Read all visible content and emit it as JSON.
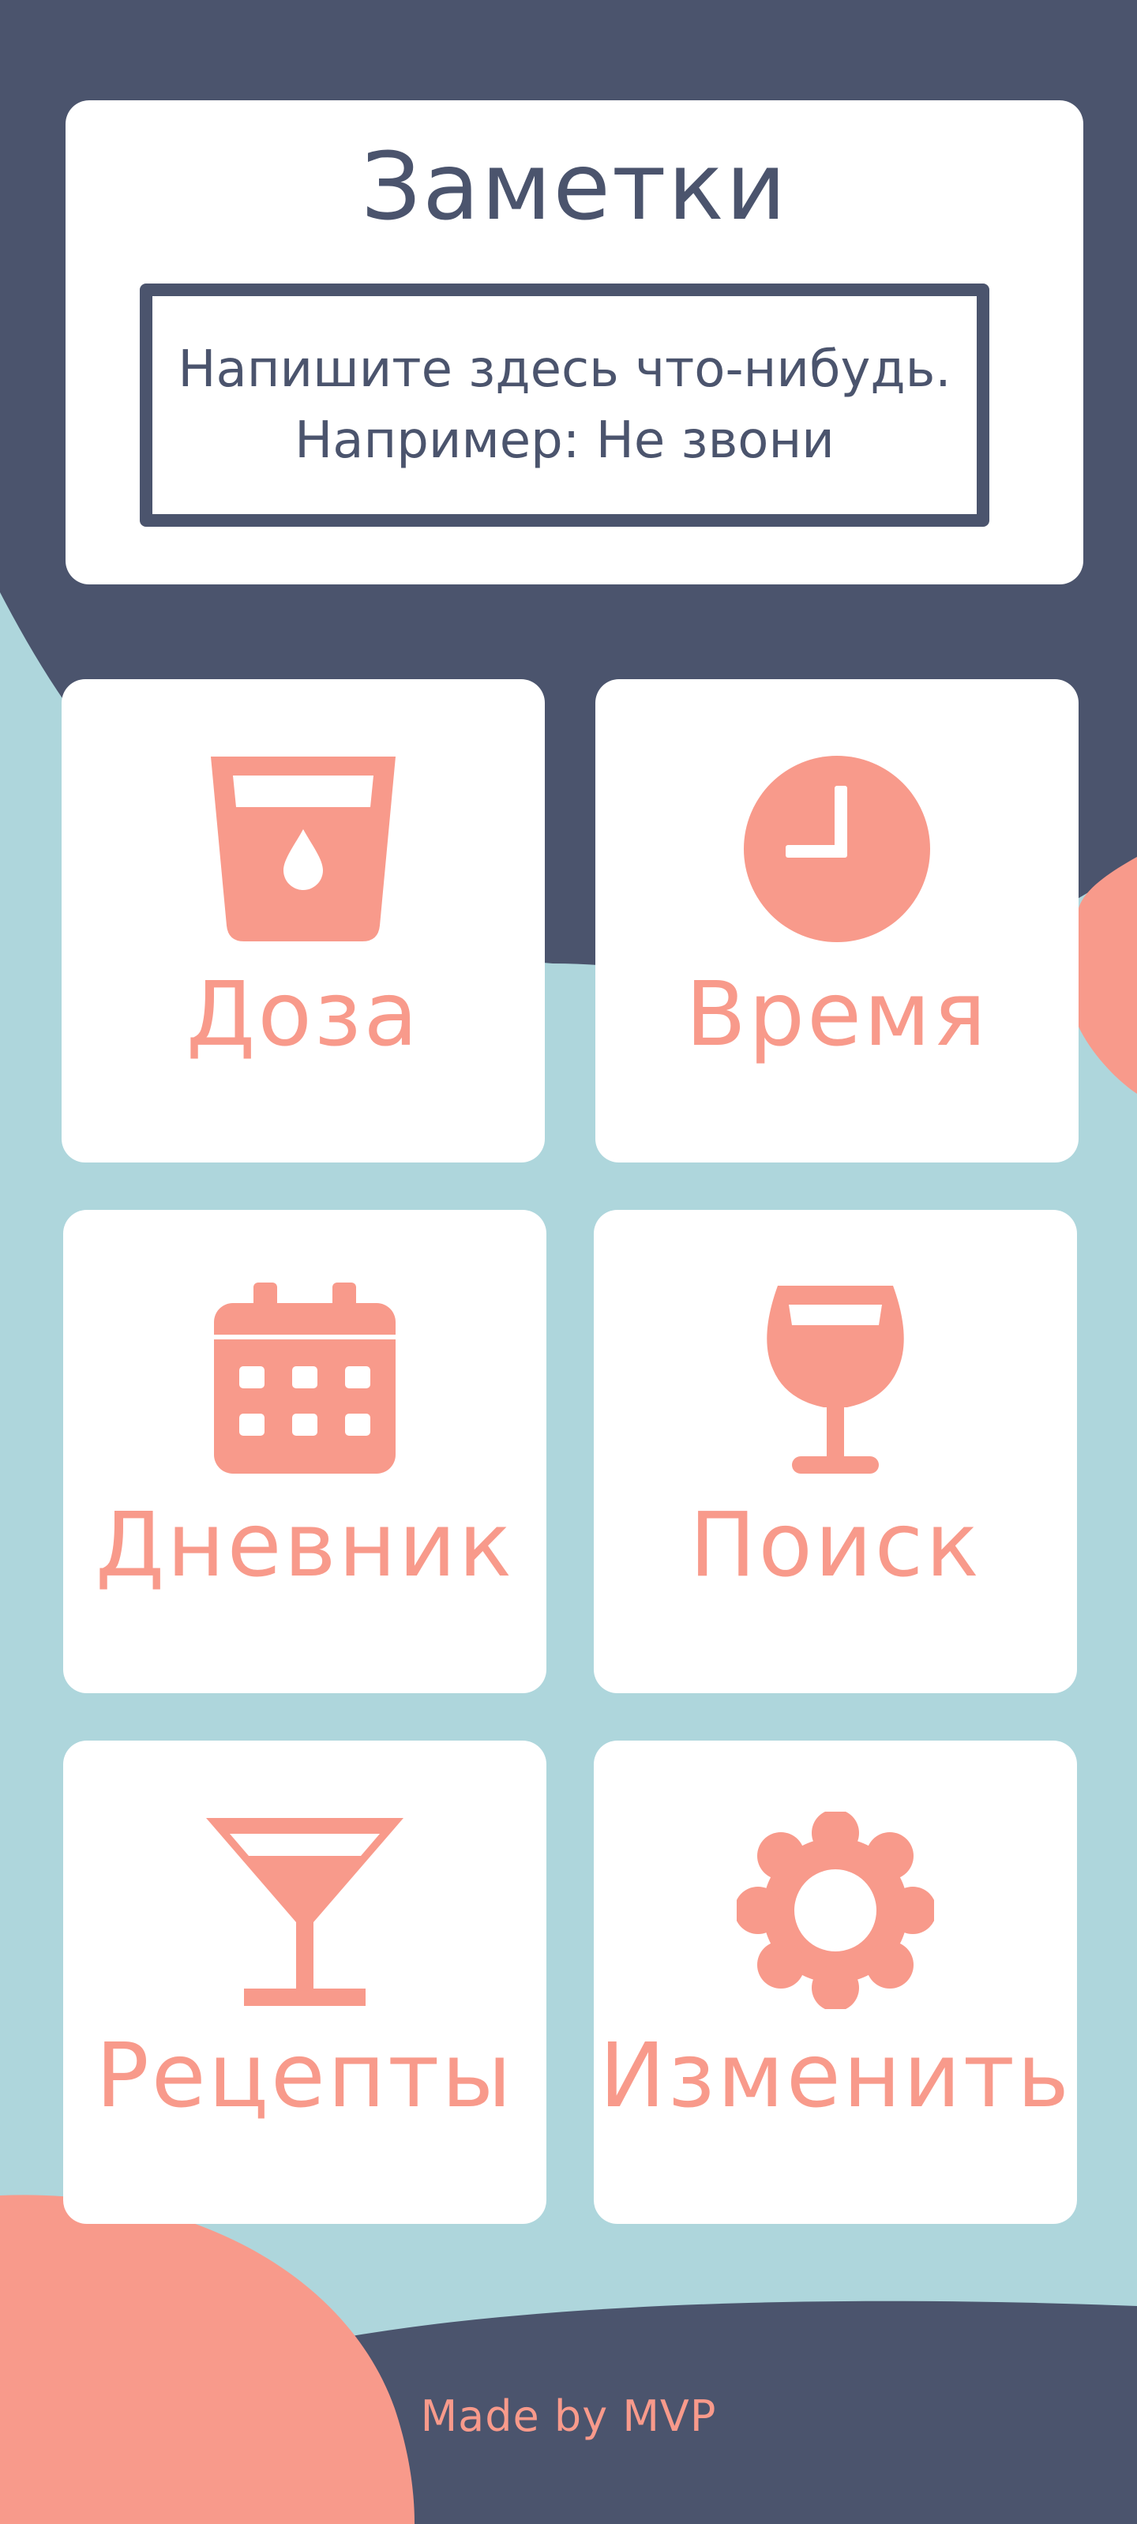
{
  "colors": {
    "navy": "#4b546d",
    "teal": "#aed6dc",
    "coral": "#f89a8b",
    "white": "#ffffff"
  },
  "notes": {
    "title": "Заметки",
    "line1": "Напишите здесь что-нибудь.",
    "line2": "Например: Не звони"
  },
  "tiles": [
    {
      "label": "Доза",
      "icon": "glass-water-drop-icon"
    },
    {
      "label": "Время",
      "icon": "clock-icon"
    },
    {
      "label": "Дневник",
      "icon": "calendar-icon"
    },
    {
      "label": "Поиск",
      "icon": "wine-glass-icon"
    },
    {
      "label": "Рецепты",
      "icon": "cocktail-glass-icon"
    },
    {
      "label": "Изменить",
      "icon": "gear-icon"
    }
  ],
  "footer": "Made by MVP"
}
